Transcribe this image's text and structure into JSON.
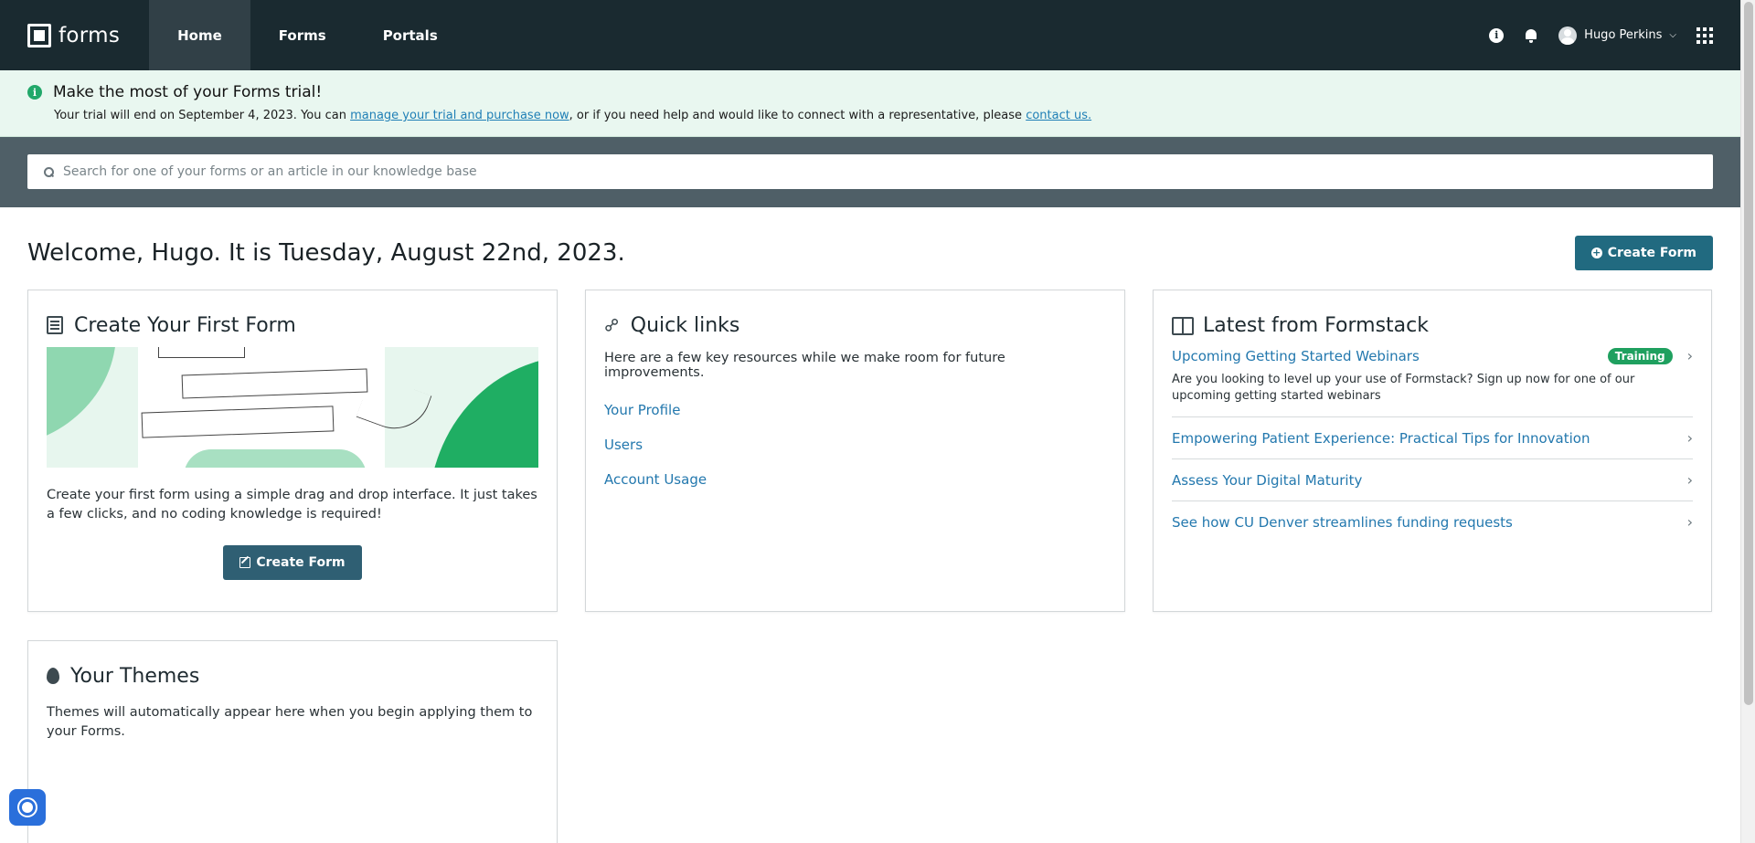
{
  "nav": {
    "logo_text": "forms",
    "tabs": [
      {
        "label": "Home",
        "active": true
      },
      {
        "label": "Forms",
        "active": false
      },
      {
        "label": "Portals",
        "active": false
      }
    ],
    "user_name": "Hugo Perkins",
    "info_glyph": "i"
  },
  "banner": {
    "info_glyph": "i",
    "title": "Make the most of your Forms trial!",
    "text_before": "Your trial will end on September 4, 2023. You can ",
    "link1": "manage your trial and purchase now",
    "text_middle": ", or if you need help and would like to connect with a representative, please ",
    "link2": "contact us."
  },
  "search": {
    "placeholder": "Search for one of your forms or an article in our knowledge base"
  },
  "welcome": {
    "text": "Welcome, Hugo. It is Tuesday, August 22nd, 2023.",
    "create_button": "Create Form"
  },
  "first_form": {
    "title": "Create Your First Form",
    "description": "Create your first form using a simple drag and drop interface. It just takes a few clicks, and no coding knowledge is required!",
    "button": "Create Form"
  },
  "quick_links": {
    "title": "Quick links",
    "description": "Here are a few key resources while we make room for future improvements.",
    "links": [
      "Your Profile",
      "Users",
      "Account Usage"
    ]
  },
  "latest": {
    "title": "Latest from Formstack",
    "items": [
      {
        "title": "Upcoming Getting Started Webinars",
        "badge": "Training",
        "description": "Are you looking to level up your use of Formstack? Sign up now for one of our upcoming getting started webinars"
      },
      {
        "title": "Empowering Patient Experience: Practical Tips for Innovation"
      },
      {
        "title": "Assess Your Digital Maturity"
      },
      {
        "title": "See how CU Denver streamlines funding requests"
      }
    ]
  },
  "themes": {
    "title": "Your Themes",
    "description": "Themes will automatically appear here when you begin applying them to your Forms."
  },
  "colors": {
    "nav_bg": "#1a2a30",
    "banner_bg": "#e9f7f0",
    "accent_green": "#1fa05f",
    "button_teal": "#216a80",
    "link_blue": "#2378ae"
  }
}
